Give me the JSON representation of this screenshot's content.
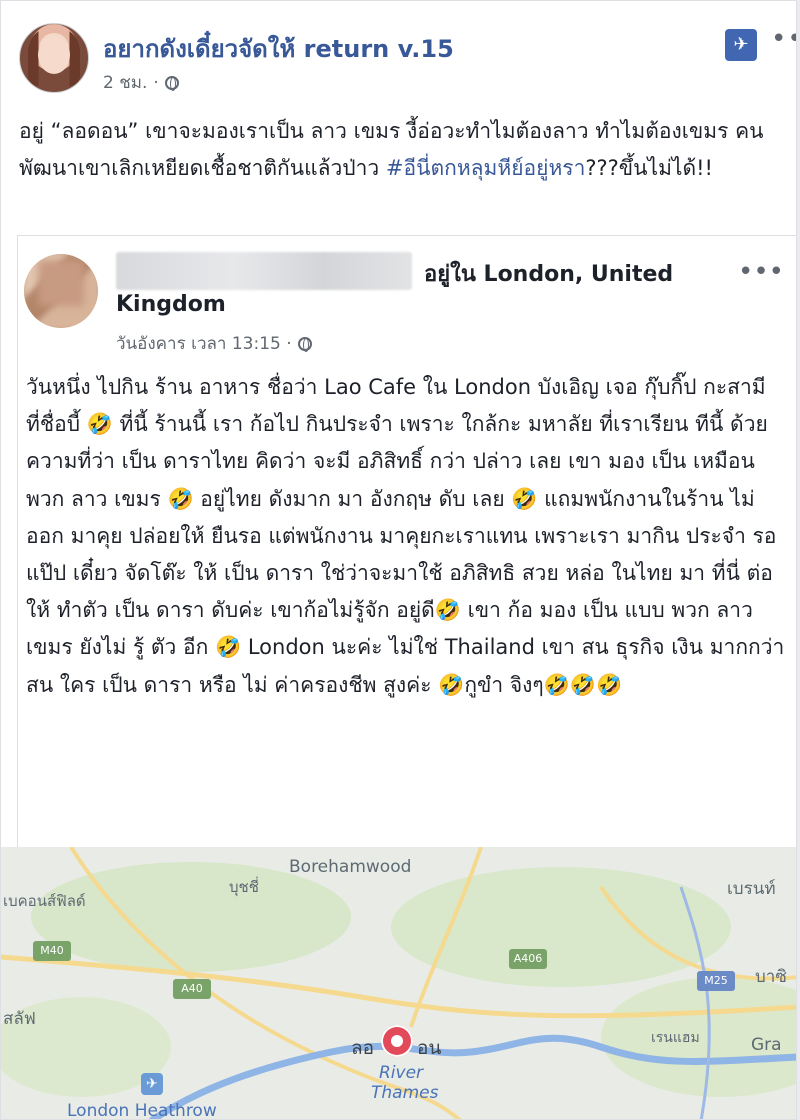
{
  "post": {
    "page_name": "อยากดังเดี๋ยวจัดให้ return v.15",
    "time": "2 ชม.",
    "text": "อยู่ “ลอดอน” เขาจะมองเราเป็น ลาว เขมร งี้อ่อวะทำไมต้องลาว ทำไมต้องเขมร คนพัฒนาเขาเลิกเหยียดเชื้อชาติกันแล้วป่าว ",
    "hashtag": "#อีนี่ตกหลุมหีย์อยู่หรา",
    "text_end": "???ขึ้นไม่ได้!!",
    "pin_icon": "pin-icon",
    "more_label": "•••"
  },
  "shared": {
    "location_line1": "อยู่ใน London, United",
    "location_line2": "Kingdom",
    "time": "วันอังคาร เวลา 13:15 ·",
    "more_label": "•••",
    "text": "วันหนึ่ง ไปกิน ร้าน อาหาร ชื่อว่า Lao Cafe ใน London บังเอิญ เจอ กุ๊บกิ๊ป กะสามี ที่ชื่อบี้ 🤣 ที่นี้ ร้านนี้ เรา ก้อไป กินประจำ เพราะ ใกล้กะ มหาลัย ที่เราเรียน ทีนี้  ด้วยความที่ว่า เป็น ดาราไทย คิดว่า จะมี อภิสิทธิ์ กว่า ปล่าว เลย เขา มอง เป็น เหมือน พวก ลาว เขมร 🤣 อยู่ไทย ดังมาก  มา อังกฤษ ดับ เลย 🤣 แถมพนักงานในร้าน ไม่ ออก มาคุย ปล่อยให้ ยืนรอ แต่พนักงาน มาคุยกะเราแทน เพราะเรา มากิน ประจำ รอแป๊ป เดี๋ยว จัดโต๊ะ ให้  เป็น ดารา ใช่ว่าจะมาใช้ อภิสิทธิ สวย หล่อ ในไทย มา ที่นี่ ต่อให้ ทำตัว เป็น ดารา  ดับค่ะ เขาก้อไม่รู้จัก อยู่ดี🤣 เขา ก้อ มอง เป็น แบบ พวก ลาว เขมร ยังไม่ รู้ ตัว อีก 🤣 London นะค่ะ ไม่ใช่ Thailand เขา สน ธุรกิจ เงิน มากกว่า สน ใคร เป็น ดารา หรือ ไม่ ค่าครองชีพ สูงค่ะ 🤣กูขำ จิงๆ🤣🤣🤣"
  },
  "map": {
    "labels": {
      "borehamwood": "Borehamwood",
      "bushey": "บุชชี่",
      "beaconsfield": "เบคอนส์ฟิลด์",
      "brentwood": "เบรนท์",
      "basildon": "บาซิ",
      "slough": "สลัฟ",
      "london": "ลอ",
      "london2": "อน",
      "river": "River",
      "thames": "Thames",
      "rainham": "เรนแฮม",
      "gravesend": "Gra",
      "heathrow": "London Heathrow"
    },
    "roads": {
      "m40": "M40",
      "a40": "A40",
      "a406": "A406",
      "m25": "M25"
    }
  }
}
